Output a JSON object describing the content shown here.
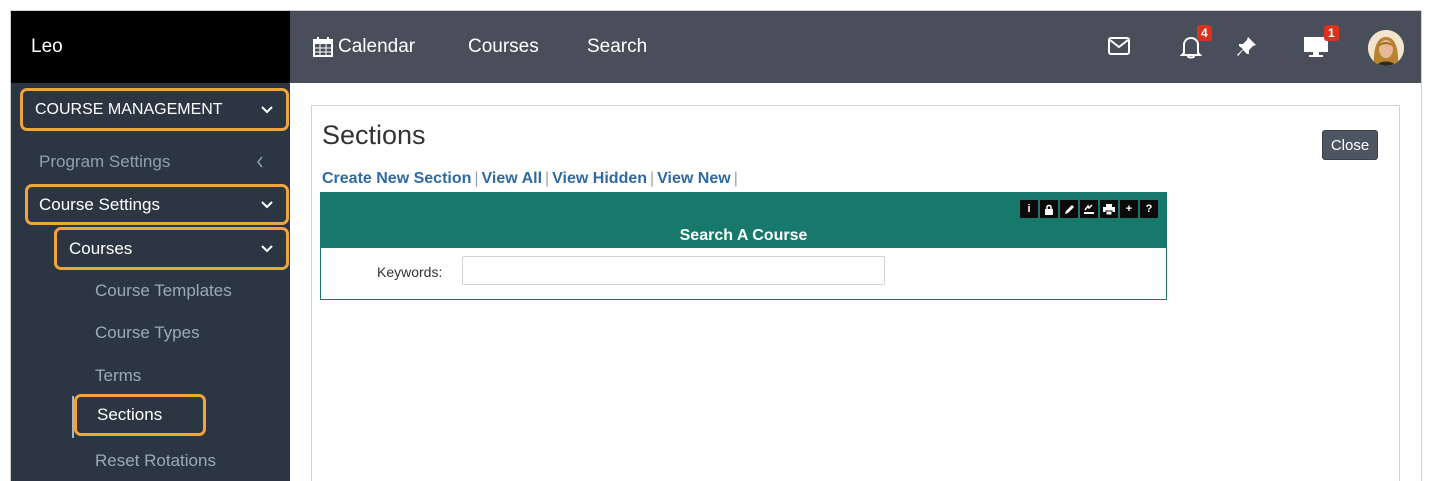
{
  "sidebar": {
    "brand": "Leo",
    "course_management": "COURSE MANAGEMENT",
    "program_settings": "Program Settings",
    "course_settings": "Course Settings",
    "courses": "Courses",
    "course_templates": "Course Templates",
    "course_types": "Course Types",
    "terms": "Terms",
    "sections": "Sections",
    "reset_rotations": "Reset Rotations"
  },
  "topbar": {
    "calendar": "Calendar",
    "courses": "Courses",
    "search": "Search",
    "notifications_count": "4",
    "monitor_count": "1"
  },
  "main": {
    "title": "Sections",
    "close": "Close",
    "links": {
      "create_new": "Create New Section",
      "view_all": "View All",
      "view_hidden": "View Hidden",
      "view_new": "View New"
    },
    "search_box": {
      "title": "Search A Course",
      "keywords_label": "Keywords:",
      "keywords_value": ""
    }
  },
  "colors": {
    "sidebar_bg": "#2b3642",
    "topbar_bg": "#484f5a",
    "highlight": "#f0a53a",
    "teal": "#16796b",
    "link": "#2f6aa3",
    "badge": "#d9321e"
  }
}
